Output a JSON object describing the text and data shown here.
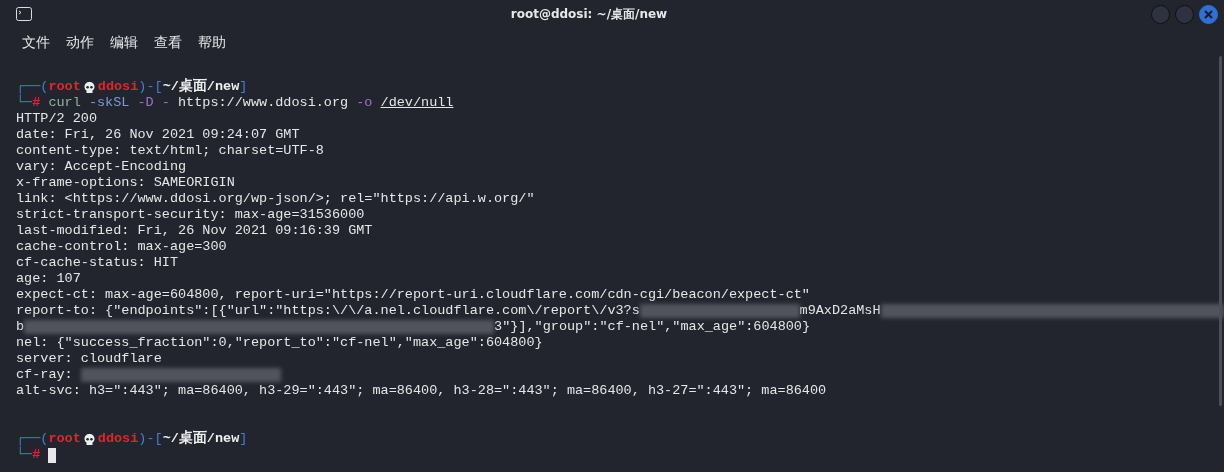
{
  "window": {
    "title": "root@ddosi: ~/桌面/new"
  },
  "menu": [
    "文件",
    "动作",
    "编辑",
    "查看",
    "帮助"
  ],
  "lines": [
    {
      "kind": "prompt",
      "open": "┌──(",
      "user": "root",
      "host": "ddosi",
      "join": ")-[",
      "path": "~/桌面/new",
      "close": "]",
      "corner": "└─",
      "symbol": "#",
      "tokens": [
        {
          "kind": "command",
          "text": "curl"
        },
        {
          "kind": "option",
          "text": "-skSL"
        },
        {
          "kind": "flag",
          "text": "-D"
        },
        {
          "kind": "flag",
          "text": "-"
        },
        {
          "kind": "plain",
          "text": "https://www.ddosi.org"
        },
        {
          "kind": "flag",
          "text": "-o"
        },
        {
          "kind": "path",
          "text": "/dev/null"
        }
      ],
      "cursor": false
    },
    {
      "kind": "output",
      "parts": [
        {
          "kind": "text",
          "text": "HTTP/2 200"
        }
      ]
    },
    {
      "kind": "output",
      "parts": [
        {
          "kind": "text",
          "text": "date: Fri, 26 Nov 2021 09:24:07 GMT"
        }
      ]
    },
    {
      "kind": "output",
      "parts": [
        {
          "kind": "text",
          "text": "content-type: text/html; charset=UTF-8"
        }
      ]
    },
    {
      "kind": "output",
      "parts": [
        {
          "kind": "text",
          "text": "vary: Accept-Encoding"
        }
      ]
    },
    {
      "kind": "output",
      "parts": [
        {
          "kind": "text",
          "text": "x-frame-options: SAMEORIGIN"
        }
      ]
    },
    {
      "kind": "output",
      "parts": [
        {
          "kind": "text",
          "text": "link: <https://www.ddosi.org/wp-json/>; rel=\"https://api.w.org/\""
        }
      ]
    },
    {
      "kind": "output",
      "parts": [
        {
          "kind": "text",
          "text": "strict-transport-security: max-age=31536000"
        }
      ]
    },
    {
      "kind": "output",
      "parts": [
        {
          "kind": "text",
          "text": "last-modified: Fri, 26 Nov 2021 09:16:39 GMT"
        }
      ]
    },
    {
      "kind": "output",
      "parts": [
        {
          "kind": "text",
          "text": "cache-control: max-age=300"
        }
      ]
    },
    {
      "kind": "output",
      "parts": [
        {
          "kind": "text",
          "text": "cf-cache-status: HIT"
        }
      ]
    },
    {
      "kind": "output",
      "parts": [
        {
          "kind": "text",
          "text": "age: 107"
        }
      ]
    },
    {
      "kind": "output",
      "parts": [
        {
          "kind": "text",
          "text": "expect-ct: max-age=604800, report-uri=\"https://report-uri.cloudflare.com/cdn-cgi/beacon/expect-ct\""
        }
      ]
    },
    {
      "kind": "output",
      "parts": [
        {
          "kind": "text",
          "text": "report-to: {\"endpoints\":[{\"url\":\"https:\\/\\/a.nel.cloudflare.com\\/report\\/v3?s"
        },
        {
          "kind": "redacted"
        },
        {
          "kind": "text",
          "text": "m9AxD2aMsH"
        },
        {
          "kind": "redacted"
        }
      ]
    },
    {
      "kind": "output",
      "parts": [
        {
          "kind": "text",
          "text": "b"
        },
        {
          "kind": "redacted"
        },
        {
          "kind": "text",
          "text": "3\"}],\"group\":\"cf-nel\",\"max_age\":604800}"
        }
      ]
    },
    {
      "kind": "output",
      "parts": [
        {
          "kind": "text",
          "text": "nel: {\"success_fraction\":0,\"report_to\":\"cf-nel\",\"max_age\":604800}"
        }
      ]
    },
    {
      "kind": "output",
      "parts": [
        {
          "kind": "text",
          "text": "server: cloudflare"
        }
      ]
    },
    {
      "kind": "output",
      "parts": [
        {
          "kind": "text",
          "text": "cf-ray:"
        },
        {
          "kind": "redacted"
        }
      ]
    },
    {
      "kind": "output",
      "parts": [
        {
          "kind": "text",
          "text": "alt-svc: h3=\":443\"; ma=86400, h3-29=\":443\"; ma=86400, h3-28=\":443\"; ma=86400, h3-27=\":443\"; ma=86400"
        }
      ]
    },
    {
      "kind": "blank"
    },
    {
      "kind": "blank"
    },
    {
      "kind": "prompt",
      "open": "┌──(",
      "user": "root",
      "host": "ddosi",
      "join": ")-[",
      "path": "~/桌面/new",
      "close": "]",
      "corner": "└─",
      "symbol": "#",
      "cursor": true
    }
  ]
}
